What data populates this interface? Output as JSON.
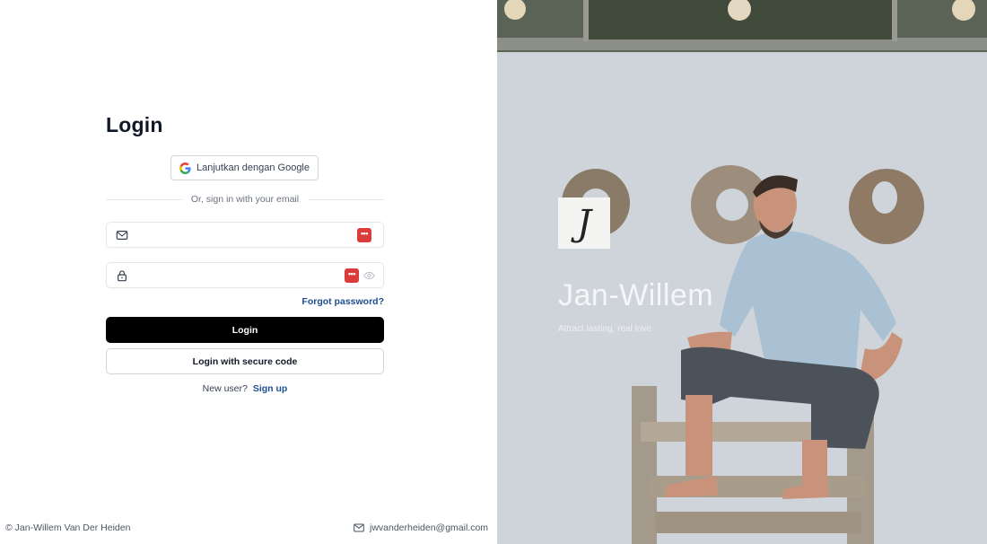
{
  "login": {
    "title": "Login",
    "google_button_label": "Lanjutkan dengan Google",
    "divider_text": "Or, sign in with your email",
    "email_input": {
      "value": "",
      "placeholder": ""
    },
    "password_input": {
      "value": "",
      "placeholder": ""
    },
    "password_manager_badge": "•••",
    "forgot_password_label": "Forgot password?",
    "login_button_label": "Login",
    "secure_code_button_label": "Login with secure code",
    "new_user_text": "New user?",
    "signup_label": "Sign up"
  },
  "footer": {
    "copyright": "© Jan-Willem Van Der Heiden",
    "email": "jwvanderheiden@gmail.com"
  },
  "brand": {
    "logo_letter": "J",
    "name": "Jan-Willem",
    "tagline": "Attract lasting, real love"
  },
  "colors": {
    "primary_button": "#000000",
    "link": "#1d4f91",
    "password_badge": "#dc3b3b"
  },
  "icons": [
    "google-icon",
    "mail-icon",
    "lock-icon",
    "password-manager-icon",
    "eye-icon",
    "envelope-icon"
  ]
}
